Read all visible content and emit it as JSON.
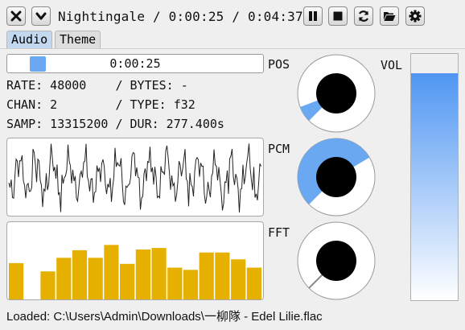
{
  "window": {
    "title": "Nightingale / 0:00:25 / 0:04:37"
  },
  "toolbar": {
    "buttons": [
      {
        "name": "close",
        "icon": "close-icon"
      },
      {
        "name": "collapse",
        "icon": "chevron-down-icon"
      },
      {
        "name": "pause",
        "icon": "pause-icon"
      },
      {
        "name": "stop",
        "icon": "stop-icon"
      },
      {
        "name": "reload",
        "icon": "reload-icon"
      },
      {
        "name": "open-folder",
        "icon": "folder-open-icon"
      },
      {
        "name": "settings",
        "icon": "gear-icon"
      }
    ]
  },
  "tabs": [
    {
      "label": "Audio",
      "active": true
    },
    {
      "label": "Theme",
      "active": false
    }
  ],
  "seek": {
    "time": "0:00:25",
    "position_fraction": 0.09
  },
  "info": {
    "line1": "RATE: 48000    / BYTES: -",
    "line2": "CHAN: 2        / TYPE: f32",
    "line3": "SAMP: 13315200 / DUR: 277.400s"
  },
  "labels": {
    "pos": "POS",
    "pcm": "PCM",
    "fft": "FFT",
    "vol": "VOL"
  },
  "knobs": {
    "pos": {
      "fraction": 0.09
    },
    "pcm": {
      "fraction": 0.72
    },
    "fft": {
      "fraction": 0.0
    }
  },
  "volume": {
    "fraction": 0.92
  },
  "fft_bars": [
    0.48,
    0.0,
    0.37,
    0.55,
    0.65,
    0.55,
    0.72,
    0.47,
    0.66,
    0.68,
    0.42,
    0.39,
    0.62,
    0.62,
    0.53,
    0.42
  ],
  "colors": {
    "accent": "#6aa8f2",
    "fft_bar": "#e6b000",
    "knob_track": "#ffffff",
    "knob_center": "#000000"
  },
  "status": {
    "text": "Loaded: C:\\Users\\Admin\\Downloads\\一柳隊 - Edel Lilie.flac"
  }
}
